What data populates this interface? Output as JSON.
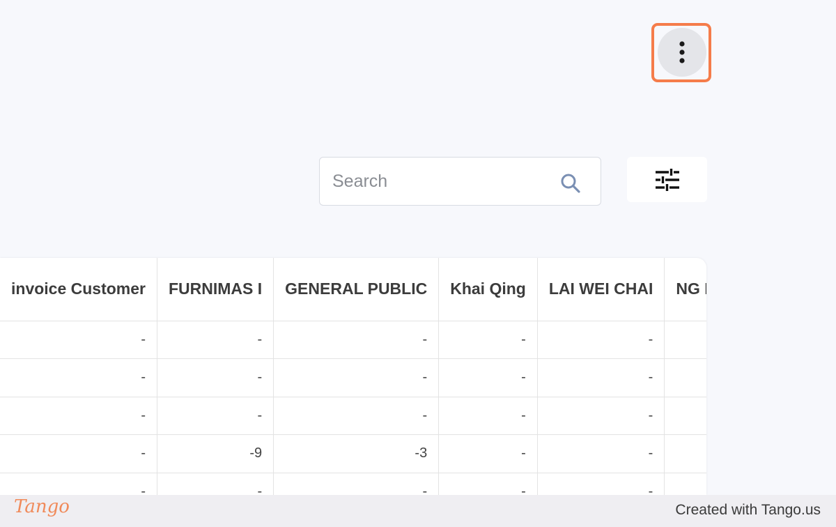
{
  "toolbar": {
    "search_placeholder": "Search",
    "more_icon": "more-vertical-icon",
    "search_icon": "search-icon",
    "filter_icon": "filter-sliders-icon"
  },
  "table": {
    "columns": [
      "invoice Customer",
      "FURNIMAS I",
      "GENERAL PUBLIC",
      "Khai Qing",
      "LAI WEI CHAI",
      "NG M"
    ],
    "rows": [
      [
        "-",
        "-",
        "-",
        "-",
        "-",
        ""
      ],
      [
        "-",
        "-",
        "-",
        "-",
        "-",
        ""
      ],
      [
        "-",
        "-",
        "-",
        "-",
        "-",
        ""
      ],
      [
        "-",
        "-9",
        "-3",
        "-",
        "-",
        ""
      ],
      [
        "-",
        "-",
        "-",
        "-",
        "-",
        ""
      ]
    ]
  },
  "footer": {
    "logo": "Tango",
    "credit": "Created with Tango.us"
  },
  "colors": {
    "highlight": "#f57c4a",
    "background": "#f7f8fc"
  }
}
